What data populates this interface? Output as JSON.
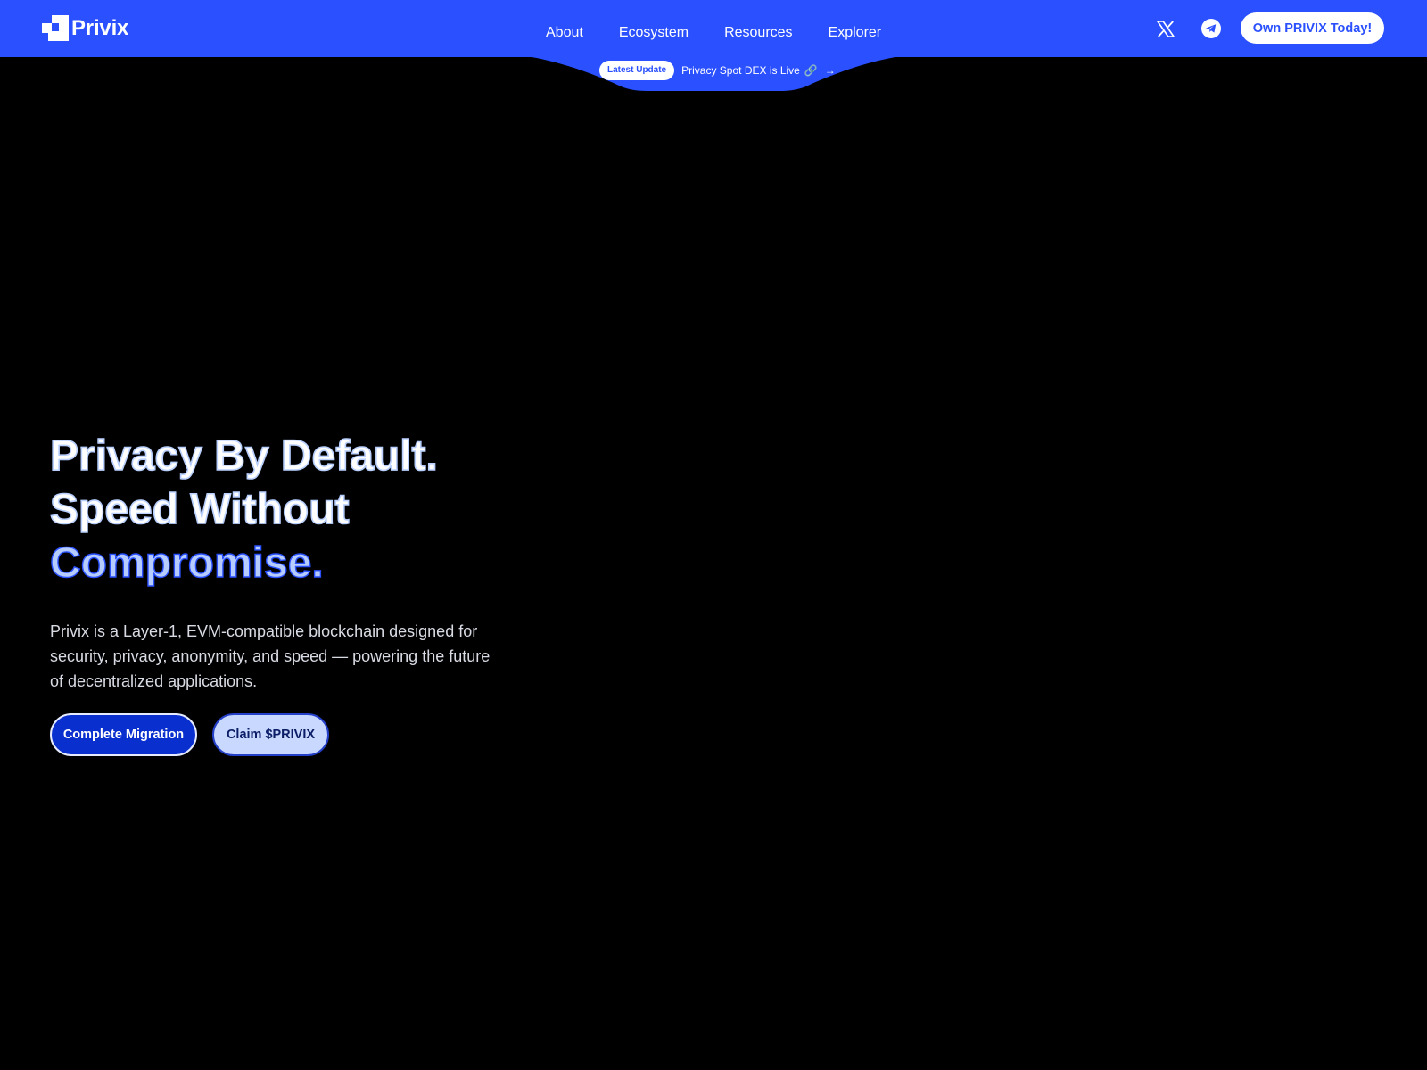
{
  "brand": {
    "name": "Privix",
    "logo_icon": "privix-logo-icon"
  },
  "colors": {
    "brand_blue": "#2a50ff",
    "background": "#000000",
    "primary_button": "#0a2fcf",
    "secondary_button": "#c9d8ff",
    "accent_text": "#b6ccfd"
  },
  "nav": {
    "links": [
      {
        "label": "About"
      },
      {
        "label": "Ecosystem"
      },
      {
        "label": "Resources"
      },
      {
        "label": "Explorer"
      }
    ],
    "social": [
      {
        "icon": "x-twitter-icon"
      },
      {
        "icon": "telegram-icon"
      }
    ],
    "cta_label": "Own PRIVIX Today!"
  },
  "update": {
    "badge": "Latest Update",
    "text": "Privacy Spot DEX is Live",
    "link_icon": "🔗",
    "arrow": "→"
  },
  "hero": {
    "title_lines": [
      "Privacy By Default.",
      "Speed Without"
    ],
    "title_accent": "Compromise.",
    "description": "Privix is a Layer-1, EVM-compatible blockchain designed for security, privacy, anonymity, and speed — powering the future of decentralized applications.",
    "primary_button": "Complete Migration",
    "secondary_button": "Claim $PRIVIX"
  }
}
